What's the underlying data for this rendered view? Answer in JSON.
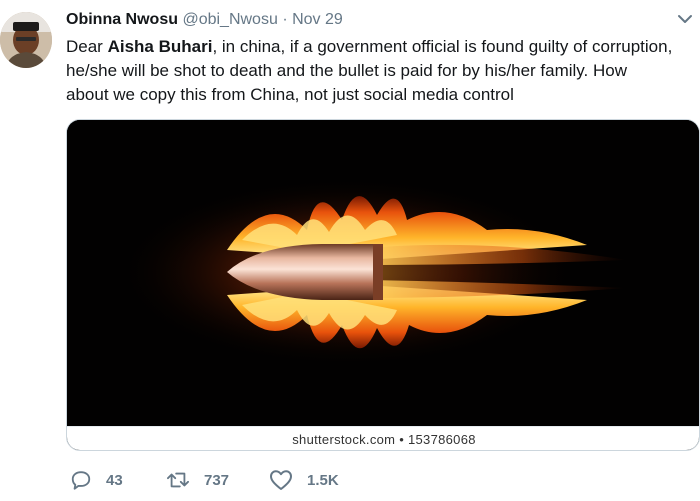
{
  "tweet": {
    "display_name": "Obinna Nwosu",
    "handle": "@obi_Nwosu",
    "separator": "·",
    "date": "Nov 29",
    "text_line1_prefix": "Dear ",
    "text_line1_mention": "Aisha Buhari",
    "text_line1_suffix": ", in china, if a government official is found guilty of corruption,",
    "text_line2": "he/she will be shot to death and the bullet is paid for by his/her family. How",
    "text_line3": "about we copy this from China, not just social media control"
  },
  "media": {
    "caption": "shutterstock.com • 153786068"
  },
  "actions": {
    "replies": "43",
    "retweets": "737",
    "likes": "1.5K"
  },
  "icons": {
    "reply": "comment-icon",
    "retweet": "retweet-icon",
    "like": "heart-icon",
    "menu": "chevron-down-icon"
  },
  "colors": {
    "text": "#14171a",
    "secondary": "#657786",
    "border": "#ccd6dd"
  }
}
